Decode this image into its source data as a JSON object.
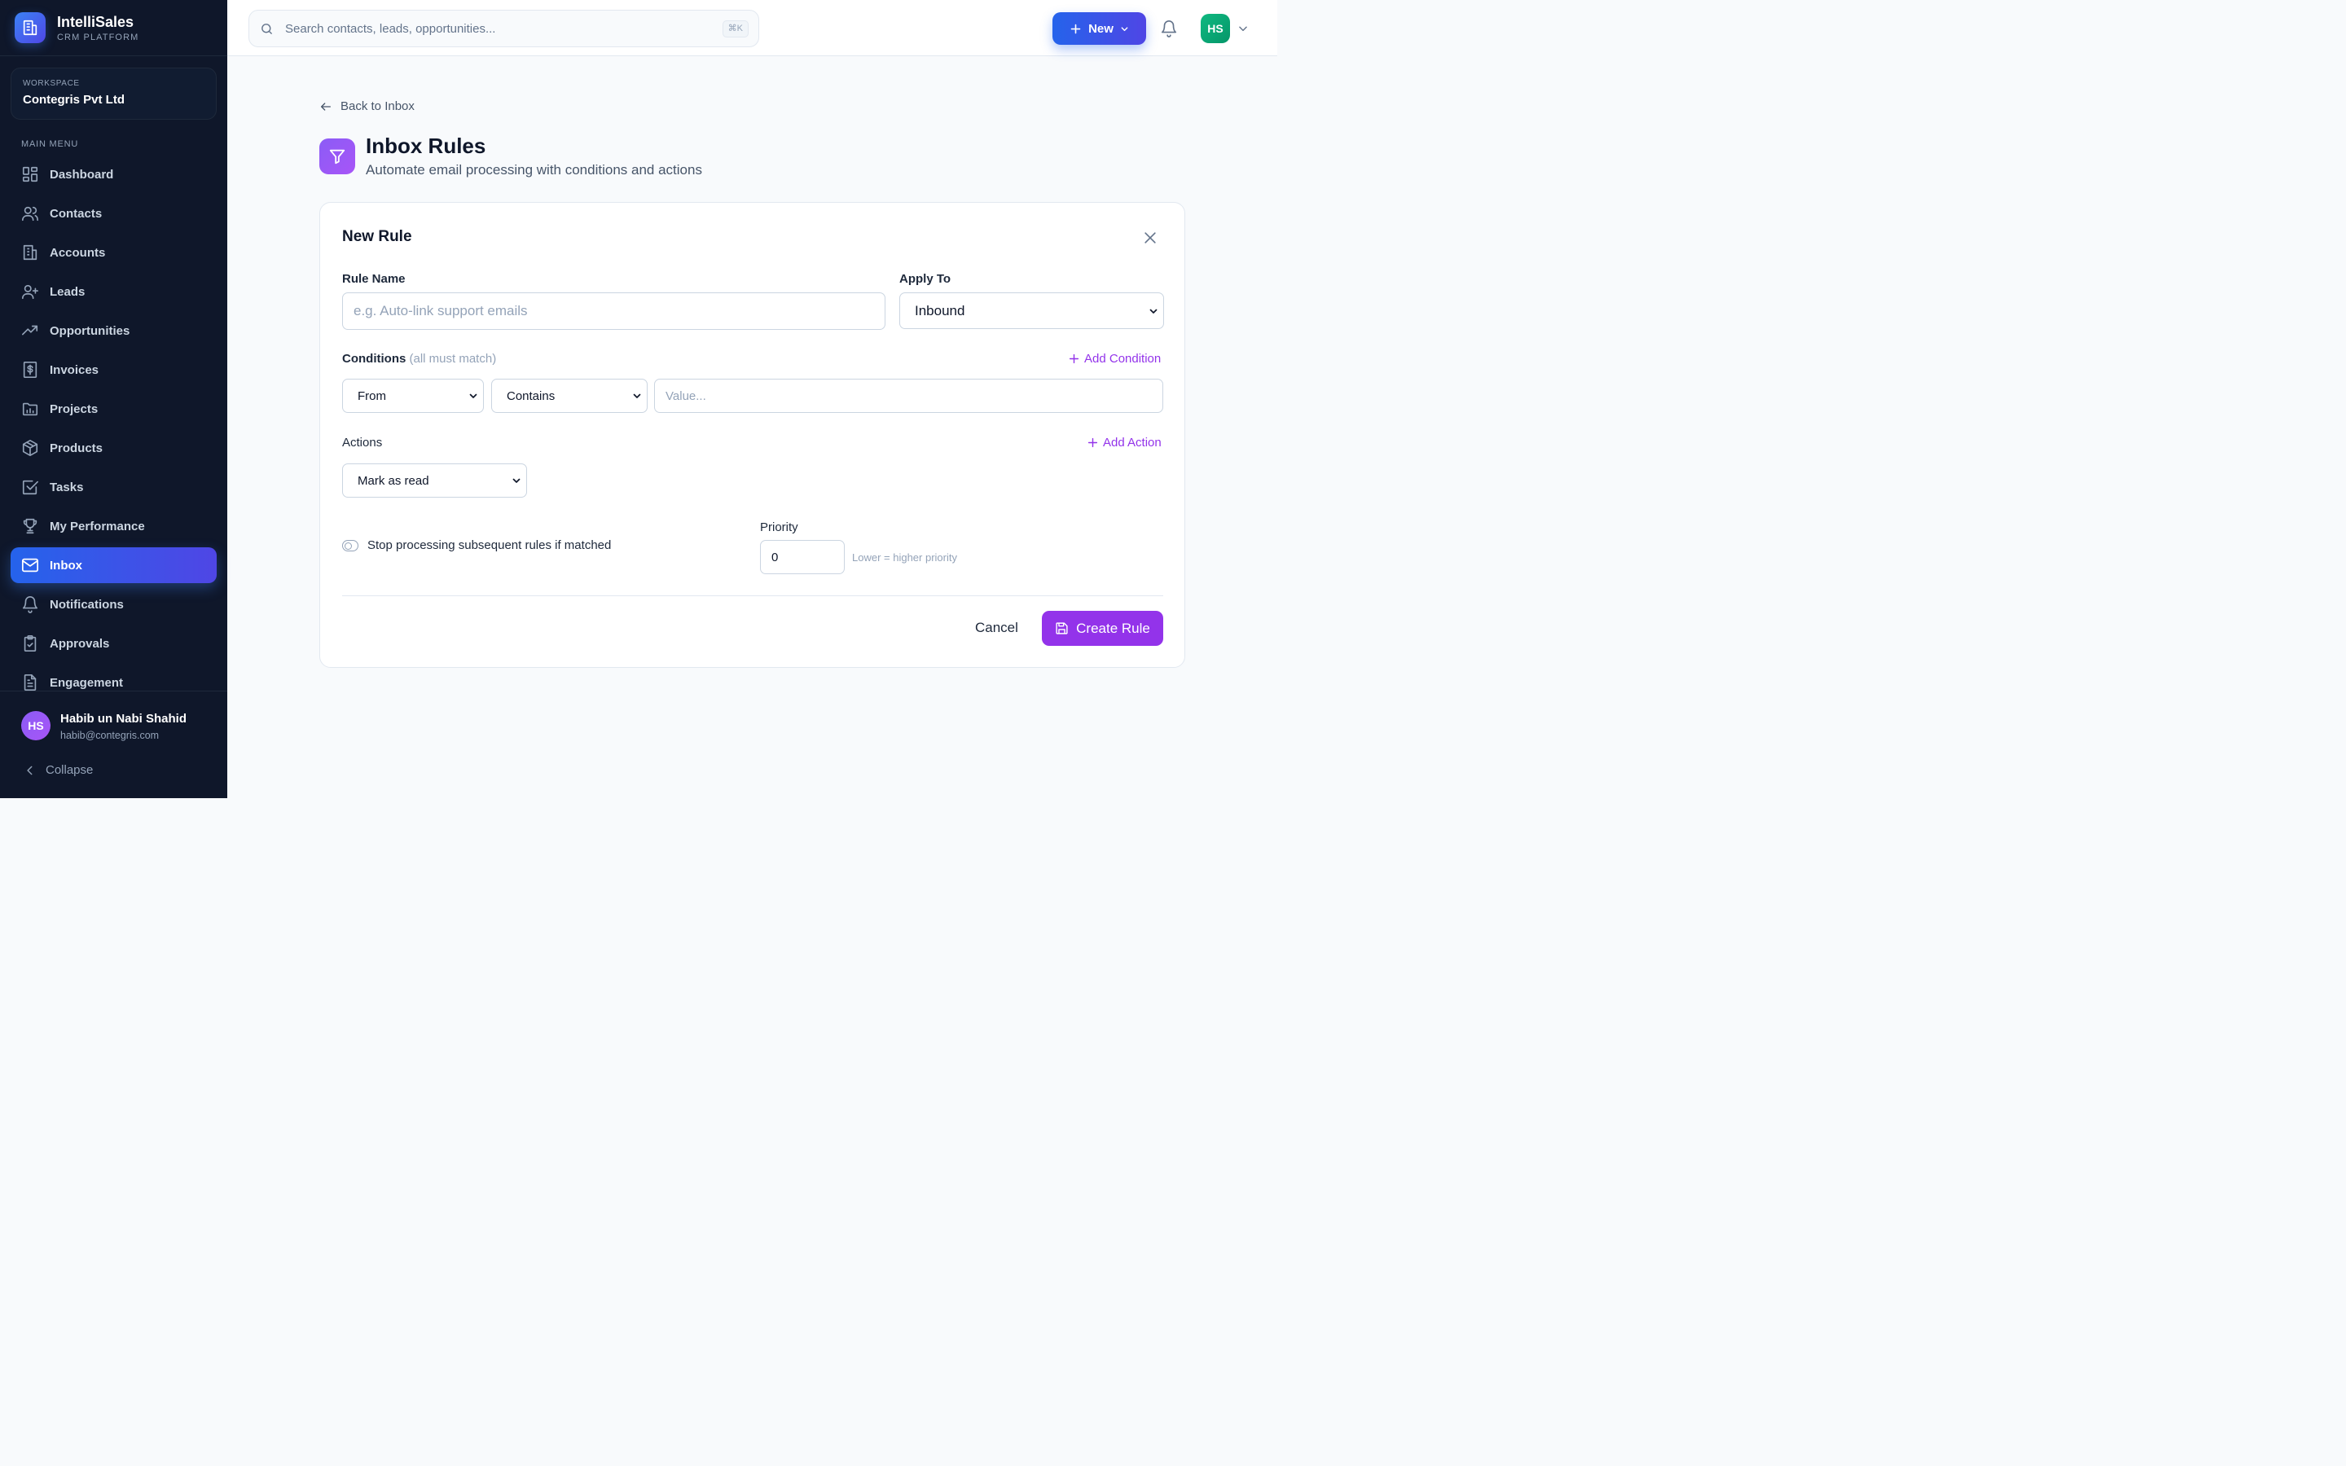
{
  "brand": {
    "name": "IntelliSales",
    "subtitle": "CRM PLATFORM"
  },
  "workspace": {
    "label": "WORKSPACE",
    "name": "Contegris Pvt Ltd"
  },
  "sidebar": {
    "menu_label": "MAIN MENU",
    "items": [
      {
        "label": "Dashboard",
        "icon": "dashboard-icon"
      },
      {
        "label": "Contacts",
        "icon": "users-icon"
      },
      {
        "label": "Accounts",
        "icon": "building-icon"
      },
      {
        "label": "Leads",
        "icon": "user-plus-icon"
      },
      {
        "label": "Opportunities",
        "icon": "trending-up-icon"
      },
      {
        "label": "Invoices",
        "icon": "receipt-icon"
      },
      {
        "label": "Projects",
        "icon": "folder-chart-icon"
      },
      {
        "label": "Products",
        "icon": "package-icon"
      },
      {
        "label": "Tasks",
        "icon": "check-square-icon"
      },
      {
        "label": "My Performance",
        "icon": "trophy-icon"
      },
      {
        "label": "Inbox",
        "icon": "mail-icon",
        "active": true
      },
      {
        "label": "Notifications",
        "icon": "bell-icon"
      },
      {
        "label": "Approvals",
        "icon": "clipboard-check-icon"
      },
      {
        "label": "Engagement",
        "icon": "file-text-icon"
      }
    ],
    "footer": {
      "avatar_initials": "HS",
      "user_name": "Habib un Nabi Shahid",
      "user_email": "habib@contegris.com",
      "collapse_label": "Collapse"
    }
  },
  "topbar": {
    "search_placeholder": "Search contacts, leads, opportunities...",
    "shortcut": "⌘K",
    "new_label": "New",
    "avatar_initials": "HS"
  },
  "page": {
    "back_label": "Back to Inbox",
    "title": "Inbox Rules",
    "subtitle": "Automate email processing with conditions and actions"
  },
  "form": {
    "title": "New Rule",
    "rule_name_label": "Rule Name",
    "rule_name_placeholder": "e.g. Auto-link support emails",
    "apply_to_label": "Apply To",
    "apply_to_value": "Inbound",
    "conditions_label": "Conditions",
    "conditions_note": "(all must match)",
    "add_condition_label": "Add Condition",
    "condition": {
      "field": "From",
      "operator": "Contains",
      "value_placeholder": "Value..."
    },
    "actions_label": "Actions",
    "add_action_label": "Add Action",
    "action_value": "Mark as read",
    "stop_processing_label": "Stop processing subsequent rules if matched",
    "priority_label": "Priority",
    "priority_value": "0",
    "priority_hint": "Lower = higher priority",
    "cancel_label": "Cancel",
    "create_label": "Create Rule"
  },
  "colors": {
    "sidebar_bg": "#0f172a",
    "primary": "#2563eb",
    "accent_purple": "#9333ea",
    "avatar_green": "#10b981"
  }
}
